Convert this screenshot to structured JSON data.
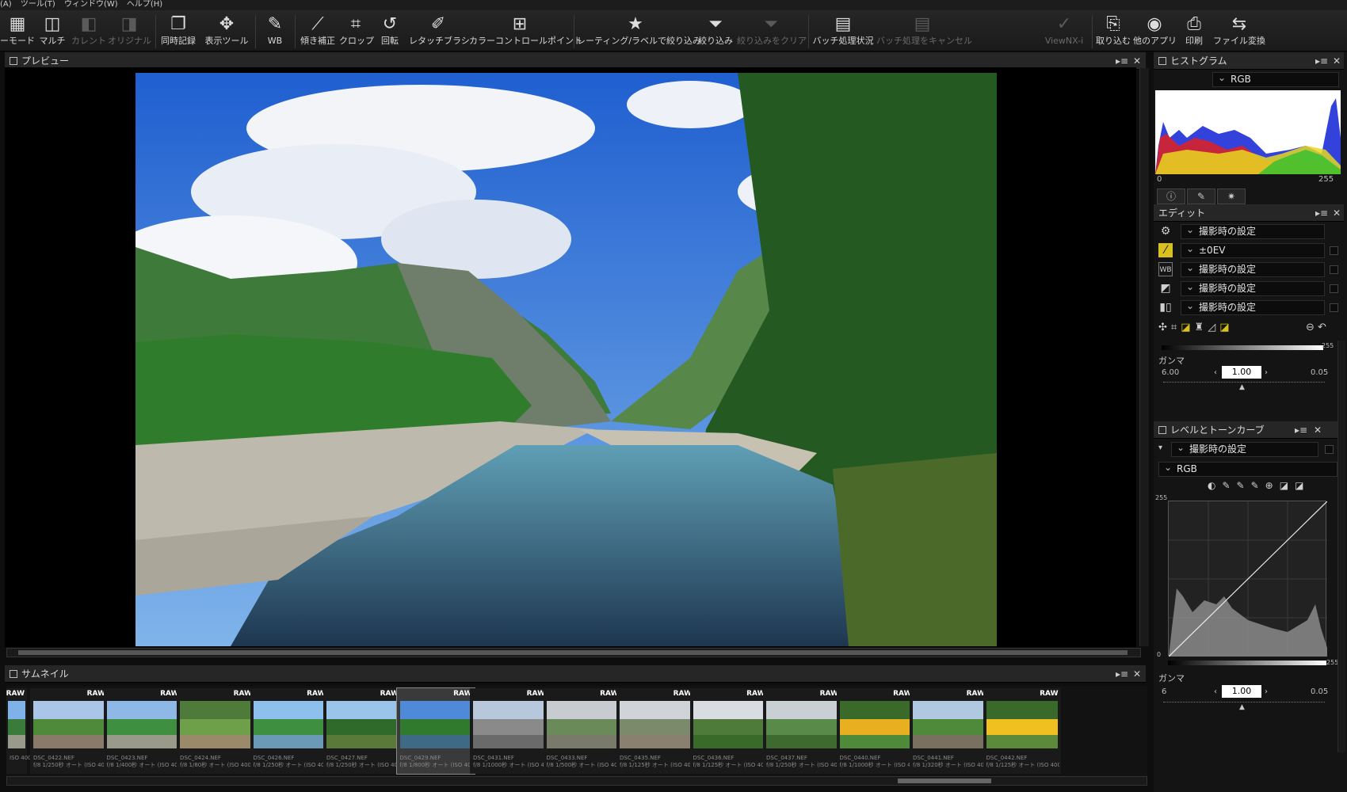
{
  "menu": [
    "(A)",
    "ツール(T)",
    "ウィンドウ(W)",
    "ヘルプ(H)"
  ],
  "toolbar": {
    "items": [
      {
        "label": "ーモード",
        "icon": "view-mode-icon",
        "disabled": false
      },
      {
        "label": "マルチ",
        "icon": "multi-icon",
        "disabled": false
      },
      {
        "label": "カレント",
        "icon": "current-icon",
        "disabled": true
      },
      {
        "label": "オリジナル",
        "icon": "original-icon",
        "disabled": true
      },
      {
        "label": "同時記録",
        "icon": "simultaneous-record-icon",
        "disabled": false
      },
      {
        "label": "表示ツール",
        "icon": "display-tool-icon",
        "disabled": false
      },
      {
        "label": "WB",
        "icon": "white-balance-icon",
        "disabled": false
      },
      {
        "label": "傾き補正",
        "icon": "straighten-icon",
        "disabled": false
      },
      {
        "label": "クロップ",
        "icon": "crop-icon",
        "disabled": false
      },
      {
        "label": "回転",
        "icon": "rotate-icon",
        "disabled": false
      },
      {
        "label": "レタッチブラシ",
        "icon": "retouch-brush-icon",
        "disabled": false
      },
      {
        "label": "カラーコントロールポイント",
        "icon": "color-control-point-icon",
        "disabled": false
      },
      {
        "label": "レーティング/ラベルで絞り込み",
        "icon": "star-icon",
        "disabled": false
      },
      {
        "label": "絞り込み",
        "icon": "filter-icon",
        "disabled": false
      },
      {
        "label": "絞り込みをクリア",
        "icon": "clear-filter-icon",
        "disabled": true
      },
      {
        "label": "バッチ処理状況",
        "icon": "batch-status-icon",
        "disabled": false
      },
      {
        "label": "バッチ処理をキャンセル",
        "icon": "batch-cancel-icon",
        "disabled": true
      },
      {
        "label": "ViewNX-i",
        "icon": "viewnx-icon",
        "disabled": true
      },
      {
        "label": "取り込む",
        "icon": "import-icon",
        "disabled": false
      },
      {
        "label": "他のアプリ",
        "icon": "other-apps-icon",
        "disabled": false
      },
      {
        "label": "印刷",
        "icon": "print-icon",
        "disabled": false
      },
      {
        "label": "ファイル変換",
        "icon": "file-convert-icon",
        "disabled": false
      }
    ]
  },
  "preview": {
    "title": "プレビュー"
  },
  "thumbnails": {
    "title": "サムネイル",
    "badge": "RAW",
    "items": [
      {
        "name": "ISO 400)",
        "info": ""
      },
      {
        "name": "DSC_0422.NEF",
        "info": "f/8 1/250秒 オート (ISO 400)"
      },
      {
        "name": "DSC_0423.NEF",
        "info": "f/8 1/400秒 オート (ISO 400)"
      },
      {
        "name": "DSC_0424.NEF",
        "info": "f/8 1/80秒 オート (ISO 400)"
      },
      {
        "name": "DSC_0426.NEF",
        "info": "f/8 1/250秒 オート (ISO 400)"
      },
      {
        "name": "DSC_0427.NEF",
        "info": "f/8 1/250秒 オート (ISO 400)"
      },
      {
        "name": "DSC_0429.NEF",
        "info": "f/8 1/800秒 オート (ISO 400)"
      },
      {
        "name": "DSC_0431.NEF",
        "info": "f/8 1/1000秒 オート (ISO 4..."
      },
      {
        "name": "DSC_0433.NEF",
        "info": "f/8 1/500秒 オート (ISO 400)"
      },
      {
        "name": "DSC_0435.NEF",
        "info": "f/8 1/125秒 オート (ISO 400)"
      },
      {
        "name": "DSC_0436.NEF",
        "info": "f/8 1/125秒 オート (ISO 400)"
      },
      {
        "name": "DSC_0437.NEF",
        "info": "f/8 1/250秒 オート (ISO 400)"
      },
      {
        "name": "DSC_0440.NEF",
        "info": "f/8 1/1000秒 オート (ISO 4..."
      },
      {
        "name": "DSC_0441.NEF",
        "info": "f/8 1/320秒 オート (ISO 400)"
      },
      {
        "name": "DSC_0442.NEF",
        "info": "f/8 1/125秒 オート (ISO 400)"
      }
    ],
    "selected_index": 6
  },
  "histogram": {
    "title": "ヒストグラム",
    "channel": "RGB",
    "min": "0",
    "max": "255"
  },
  "edit": {
    "title": "エディット",
    "rows": [
      {
        "icon": "gear-icon",
        "value": "撮影時の設定"
      },
      {
        "icon": "exposure-icon",
        "value": "±0EV"
      },
      {
        "icon": "wb-icon",
        "value": "撮影時の設定"
      },
      {
        "icon": "picture-control-icon",
        "value": "撮影時の設定"
      },
      {
        "icon": "dlighting-icon",
        "value": "撮影時の設定"
      }
    ],
    "gamma_label": "ガンマ",
    "gamma_min": "6.00",
    "gamma_value": "1.00",
    "gamma_max": "0.05",
    "max_tag": "255"
  },
  "levels": {
    "title": "レベルとトーンカーブ",
    "preset": "撮影時の設定",
    "channel": "RGB",
    "top_tag": "255",
    "bottom_tag": "0",
    "right_tag": "255",
    "gamma_label": "ガンマ",
    "gamma_min": "6",
    "gamma_value": "1.00",
    "gamma_max": "0.05"
  },
  "colors": {
    "accent": "#3a7bd5"
  }
}
